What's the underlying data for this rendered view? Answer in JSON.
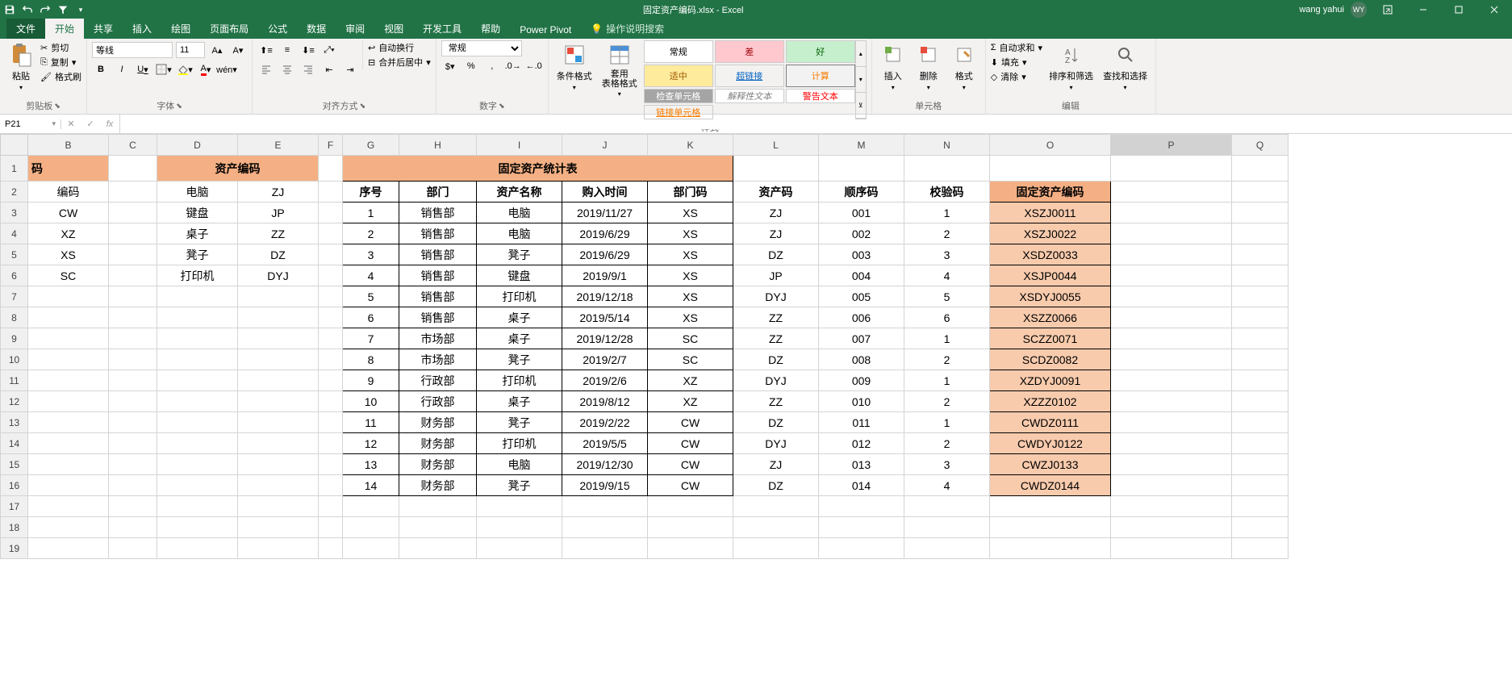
{
  "title": "固定资产编码.xlsx  -  Excel",
  "user": {
    "name": "wang yahui",
    "initials": "WY"
  },
  "tabs": {
    "file": "文件",
    "home": "开始",
    "share": "共享",
    "insert": "插入",
    "draw": "绘图",
    "layout": "页面布局",
    "formulas": "公式",
    "data": "数据",
    "review": "审阅",
    "view": "视图",
    "devtools": "开发工具",
    "help": "帮助",
    "powerpivot": "Power Pivot",
    "tellme": "操作说明搜索"
  },
  "ribbon": {
    "clipboard": {
      "paste": "粘贴",
      "cut": "剪切",
      "copy": "复制",
      "fmtpainter": "格式刷",
      "label": "剪贴板"
    },
    "font": {
      "name": "等线",
      "size": "11",
      "bold": "B",
      "italic": "I",
      "underline": "U",
      "label": "字体"
    },
    "align": {
      "wrap": "自动换行",
      "merge": "合并后居中",
      "label": "对齐方式"
    },
    "number": {
      "format": "常规",
      "label": "数字"
    },
    "styles": {
      "cond": "条件格式",
      "astable": "套用\n表格格式",
      "normal": "常规",
      "bad": "差",
      "good": "好",
      "neutral": "适中",
      "calc": "计算",
      "check": "检查单元格",
      "explain": "解释性文本",
      "warn": "警告文本",
      "hyper": "超链接",
      "linked": "链接单元格",
      "label": "样式"
    },
    "cells": {
      "insert": "插入",
      "delete": "删除",
      "format": "格式",
      "label": "单元格"
    },
    "editing": {
      "sum": "自动求和",
      "fill": "填充",
      "clear": "清除",
      "sort": "排序和筛选",
      "find": "查找和选择",
      "label": "编辑"
    }
  },
  "namebox": "P21",
  "formula": "",
  "colheads": [
    "B",
    "C",
    "D",
    "E",
    "F",
    "G",
    "H",
    "I",
    "J",
    "K",
    "L",
    "M",
    "N",
    "O",
    "P",
    "Q"
  ],
  "sheet": {
    "b1": "码",
    "de1": "资产编码",
    "gk1": "固定资产统计表",
    "o1": "",
    "hdr": {
      "b": "编码",
      "d": "电脑",
      "e": "ZJ",
      "g": "序号",
      "h": "部门",
      "i": "资产名称",
      "j": "购入时间",
      "k": "部门码",
      "l": "资产码",
      "m": "顺序码",
      "n": "校验码",
      "o": "固定资产编码"
    },
    "lk1": {
      "b": "CW",
      "d": "键盘",
      "e": "JP"
    },
    "lk2": {
      "b": "XZ",
      "d": "桌子",
      "e": "ZZ"
    },
    "lk3": {
      "b": "XS",
      "d": "凳子",
      "e": "DZ"
    },
    "lk4": {
      "b": "SC",
      "d": "打印机",
      "e": "DYJ"
    },
    "rows": [
      {
        "g": "1",
        "h": "销售部",
        "i": "电脑",
        "j": "2019/11/27",
        "k": "XS",
        "l": "ZJ",
        "m": "001",
        "n": "1",
        "o": "XSZJ0011"
      },
      {
        "g": "2",
        "h": "销售部",
        "i": "电脑",
        "j": "2019/6/29",
        "k": "XS",
        "l": "ZJ",
        "m": "002",
        "n": "2",
        "o": "XSZJ0022"
      },
      {
        "g": "3",
        "h": "销售部",
        "i": "凳子",
        "j": "2019/6/29",
        "k": "XS",
        "l": "DZ",
        "m": "003",
        "n": "3",
        "o": "XSDZ0033"
      },
      {
        "g": "4",
        "h": "销售部",
        "i": "键盘",
        "j": "2019/9/1",
        "k": "XS",
        "l": "JP",
        "m": "004",
        "n": "4",
        "o": "XSJP0044"
      },
      {
        "g": "5",
        "h": "销售部",
        "i": "打印机",
        "j": "2019/12/18",
        "k": "XS",
        "l": "DYJ",
        "m": "005",
        "n": "5",
        "o": "XSDYJ0055"
      },
      {
        "g": "6",
        "h": "销售部",
        "i": "桌子",
        "j": "2019/5/14",
        "k": "XS",
        "l": "ZZ",
        "m": "006",
        "n": "6",
        "o": "XSZZ0066"
      },
      {
        "g": "7",
        "h": "市场部",
        "i": "桌子",
        "j": "2019/12/28",
        "k": "SC",
        "l": "ZZ",
        "m": "007",
        "n": "1",
        "o": "SCZZ0071"
      },
      {
        "g": "8",
        "h": "市场部",
        "i": "凳子",
        "j": "2019/2/7",
        "k": "SC",
        "l": "DZ",
        "m": "008",
        "n": "2",
        "o": "SCDZ0082"
      },
      {
        "g": "9",
        "h": "行政部",
        "i": "打印机",
        "j": "2019/2/6",
        "k": "XZ",
        "l": "DYJ",
        "m": "009",
        "n": "1",
        "o": "XZDYJ0091"
      },
      {
        "g": "10",
        "h": "行政部",
        "i": "桌子",
        "j": "2019/8/12",
        "k": "XZ",
        "l": "ZZ",
        "m": "010",
        "n": "2",
        "o": "XZZZ0102"
      },
      {
        "g": "11",
        "h": "财务部",
        "i": "凳子",
        "j": "2019/2/22",
        "k": "CW",
        "l": "DZ",
        "m": "011",
        "n": "1",
        "o": "CWDZ0111"
      },
      {
        "g": "12",
        "h": "财务部",
        "i": "打印机",
        "j": "2019/5/5",
        "k": "CW",
        "l": "DYJ",
        "m": "012",
        "n": "2",
        "o": "CWDYJ0122"
      },
      {
        "g": "13",
        "h": "财务部",
        "i": "电脑",
        "j": "2019/12/30",
        "k": "CW",
        "l": "ZJ",
        "m": "013",
        "n": "3",
        "o": "CWZJ0133"
      },
      {
        "g": "14",
        "h": "财务部",
        "i": "凳子",
        "j": "2019/9/15",
        "k": "CW",
        "l": "DZ",
        "m": "014",
        "n": "4",
        "o": "CWDZ0144"
      }
    ]
  }
}
